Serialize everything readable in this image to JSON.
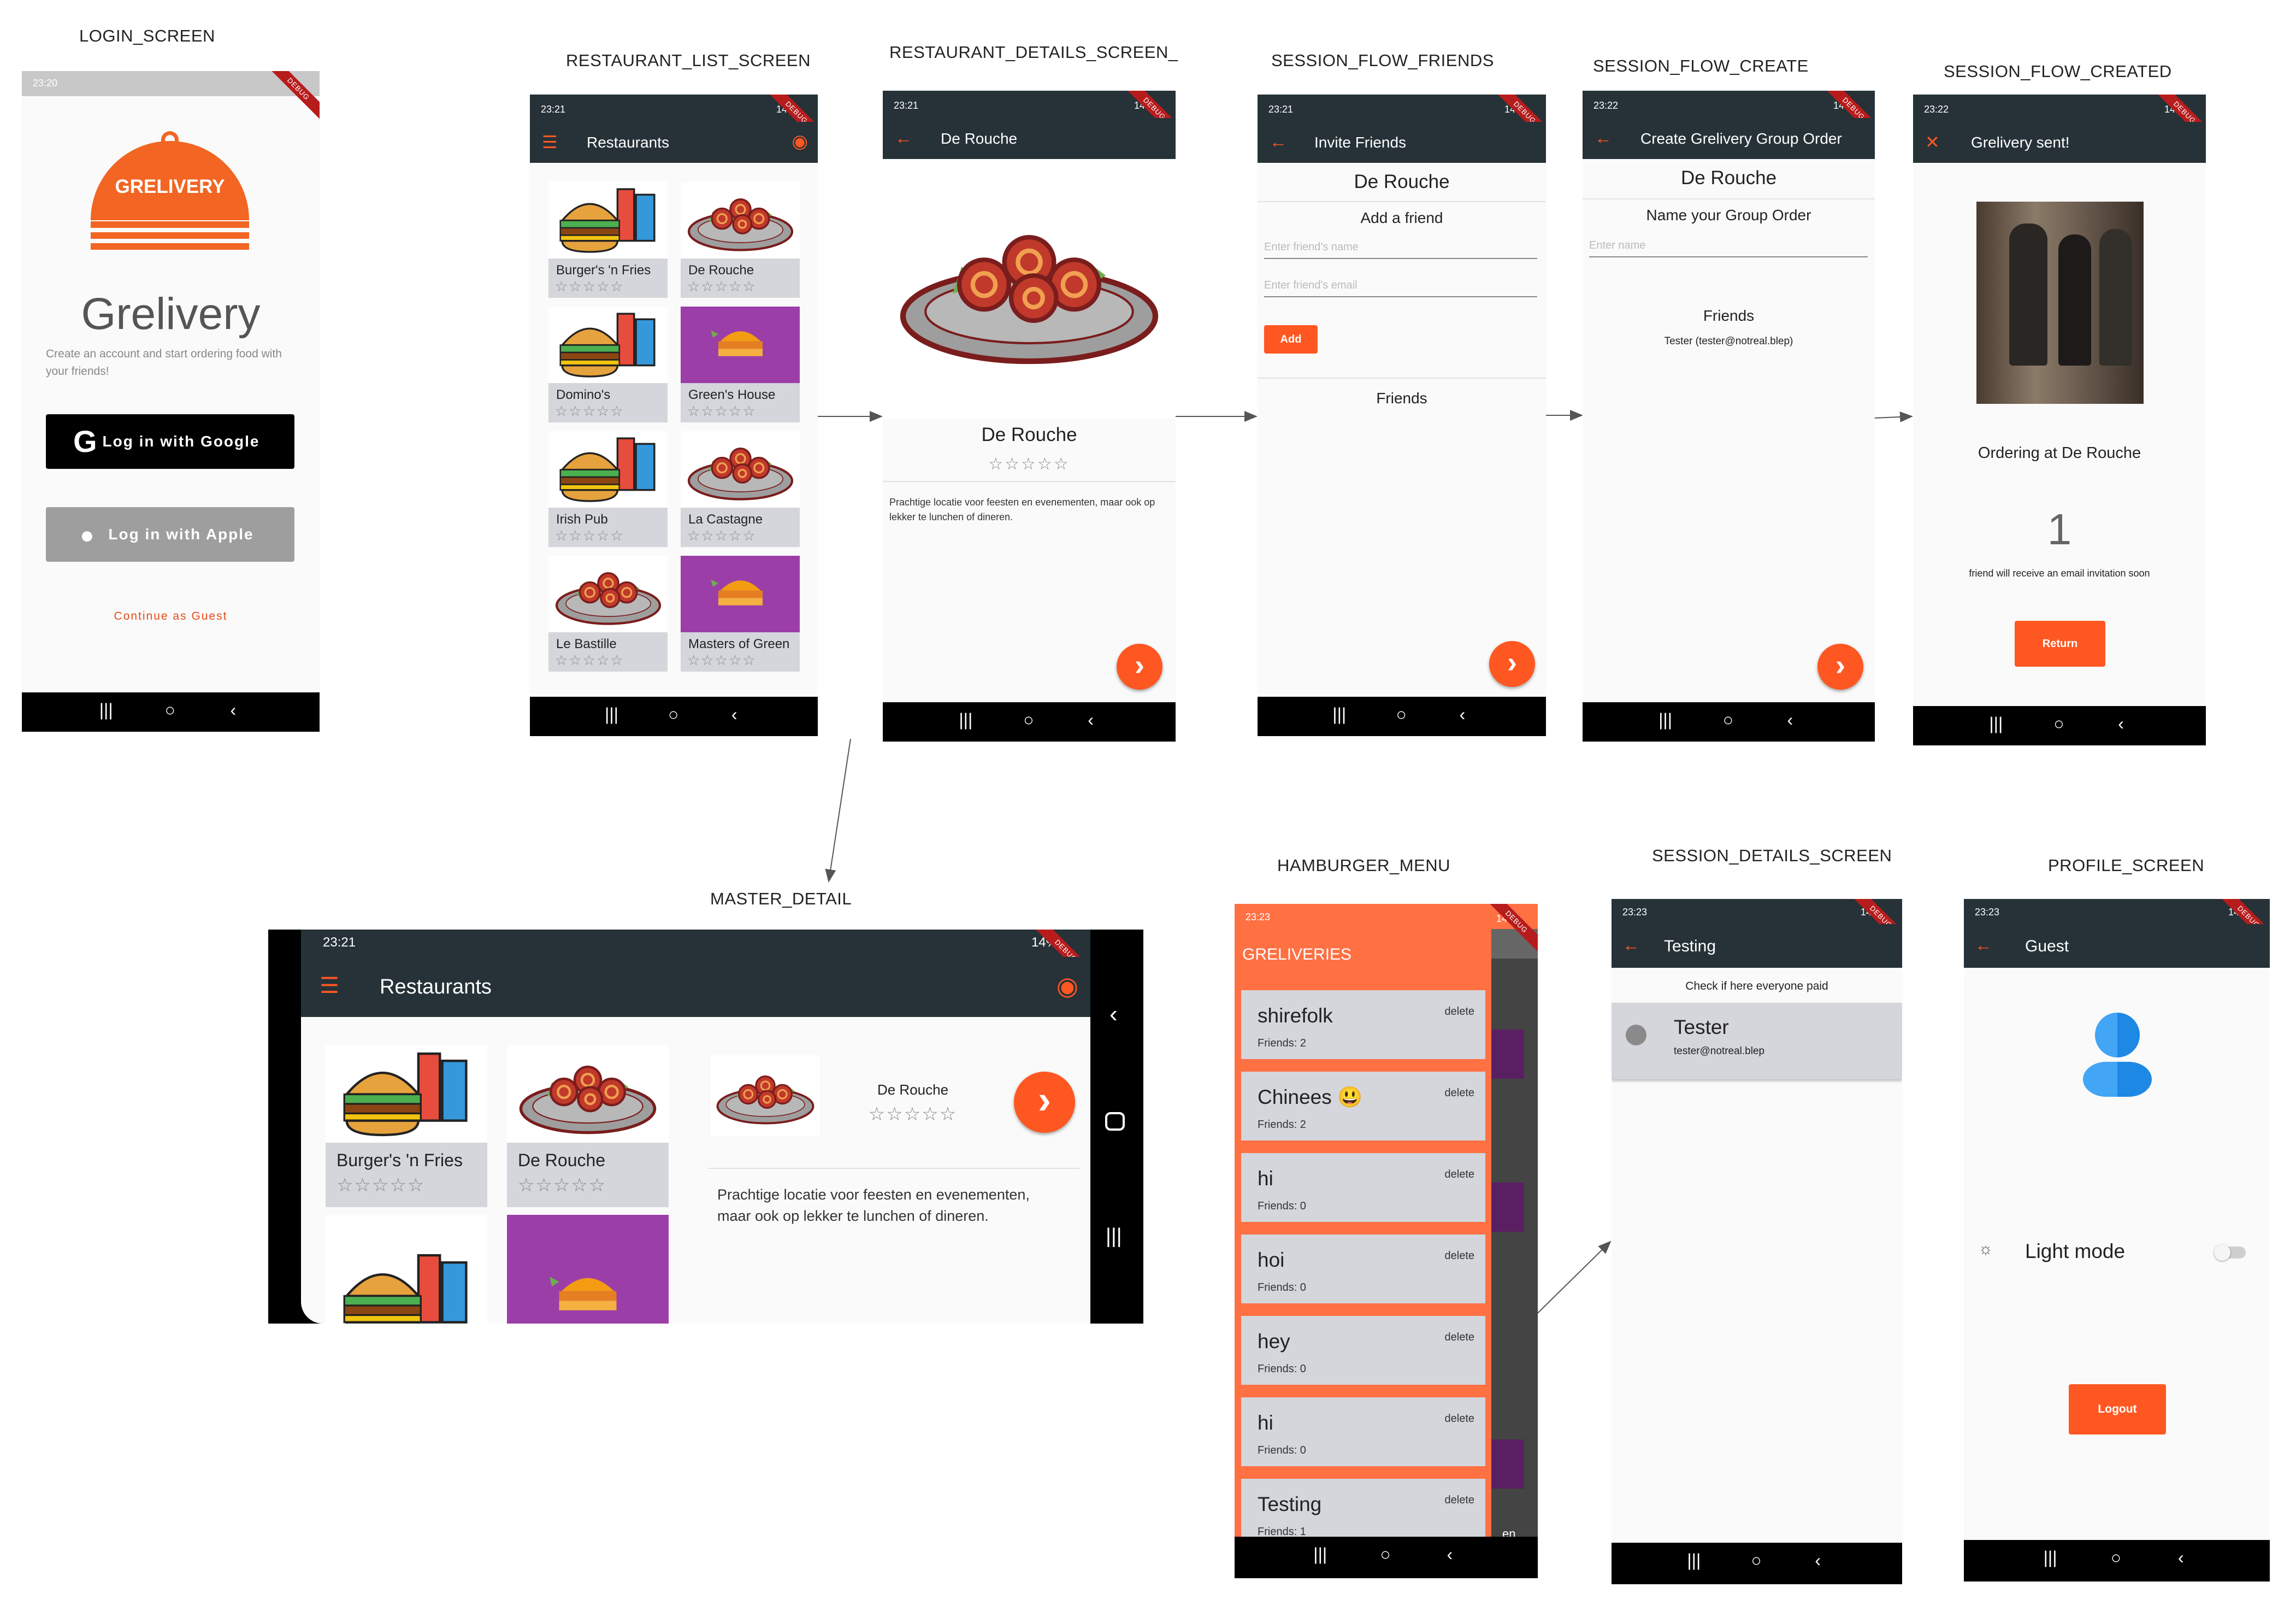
{
  "labels": {
    "login": "LOGIN_SCREEN",
    "restaurant_list": "RESTAURANT_LIST_SCREEN",
    "restaurant_details": "RESTAURANT_DETAILS_SCREEN_",
    "session_friends": "SESSION_FLOW_FRIENDS",
    "session_create": "SESSION_FLOW_CREATE",
    "session_created": "SESSION_FLOW_CREATED",
    "master_detail": "MASTER_DETAIL",
    "hamburger_menu": "HAMBURGER_MENU",
    "session_details": "SESSION_DETAILS_SCREEN",
    "profile": "PROFILE_SCREEN"
  },
  "status": {
    "t2320": "23:20",
    "t2321": "23:21",
    "t2322": "23:22",
    "t2323": "23:23",
    "battery": "14%",
    "debug": "DEBUG"
  },
  "login": {
    "logo_text": "GRELIVERY",
    "app_name": "Grelivery",
    "tagline": "Create an account and start ordering food with your friends!",
    "google_label": "Log in with  Google",
    "apple_label": "Log in with  Apple",
    "guest_label": "Continue as Guest"
  },
  "restaurants": {
    "title": "Restaurants",
    "items": [
      {
        "name": "Burger's 'n Fries",
        "stars": "☆☆☆☆☆"
      },
      {
        "name": "De Rouche",
        "stars": "☆☆☆☆☆"
      },
      {
        "name": "Domino's",
        "stars": "☆☆☆☆☆"
      },
      {
        "name": "Green's House",
        "stars": "☆☆☆☆☆"
      },
      {
        "name": "Irish Pub",
        "stars": "☆☆☆☆☆"
      },
      {
        "name": "La Castagne",
        "stars": "☆☆☆☆☆"
      },
      {
        "name": "Le Bastille",
        "stars": "☆☆☆☆☆"
      },
      {
        "name": "Masters of Green",
        "stars": "☆☆☆☆☆"
      }
    ]
  },
  "details": {
    "title": "De Rouche",
    "name": "De Rouche",
    "stars": "☆☆☆☆☆",
    "description": "Prachtige locatie voor feesten en evenementen, maar ook op lekker te lunchen of dineren."
  },
  "invite": {
    "title": "Invite Friends",
    "restaurant": "De Rouche",
    "subtitle": "Add a friend",
    "name_placeholder": "Enter friend's name",
    "email_placeholder": "Enter friend's email",
    "add_label": "Add",
    "friends_heading": "Friends"
  },
  "create": {
    "title": "Create Grelivery Group Order",
    "restaurant": "De Rouche",
    "subtitle": "Name your Group Order",
    "name_placeholder": "Enter name",
    "friends_heading": "Friends",
    "friend": "Tester (tester@notreal.blep)"
  },
  "created": {
    "title": "Grelivery sent!",
    "ordering": "Ordering at De Rouche",
    "count": "1",
    "note": "friend will receive an email invitation soon",
    "return_label": "Return"
  },
  "master": {
    "title": "Restaurants",
    "time": "23:21",
    "detail_name": "De Rouche",
    "detail_stars": "☆☆☆☆☆",
    "detail_description": "Prachtige locatie voor feesten en evenementen, maar ook op lekker te lunchen of dineren.",
    "cards": [
      {
        "name": "Burger's 'n Fries",
        "stars": "☆☆☆☆☆"
      },
      {
        "name": "De Rouche",
        "stars": "☆☆☆☆☆"
      }
    ]
  },
  "hamburger": {
    "header": "GRELIVERIES",
    "delete_label": "delete",
    "items": [
      {
        "name": "shirefolk",
        "friends": "Friends: 2"
      },
      {
        "name": "Chinees 😃",
        "friends": "Friends: 2"
      },
      {
        "name": "hi",
        "friends": "Friends: 0"
      },
      {
        "name": "hoi",
        "friends": "Friends: 0"
      },
      {
        "name": "hey",
        "friends": "Friends: 0"
      },
      {
        "name": "hi",
        "friends": "Friends: 0"
      },
      {
        "name": "Testing",
        "friends": "Friends: 1"
      }
    ],
    "partial_text": "en"
  },
  "session_details": {
    "title": "Testing",
    "check_text": "Check if here everyone paid",
    "member_name": "Tester",
    "member_email": "tester@notreal.blep"
  },
  "profile": {
    "title": "Guest",
    "light_mode": "Light mode",
    "logout_label": "Logout"
  },
  "icons": {
    "menu": "☰",
    "back": "←",
    "close": "✕",
    "next": "›",
    "user": "◉",
    "sun": "☼"
  },
  "colors": {
    "appbar": "#263238",
    "accent": "#ff5722",
    "card": "#d4d6dc",
    "drawer": "#ff7043"
  }
}
